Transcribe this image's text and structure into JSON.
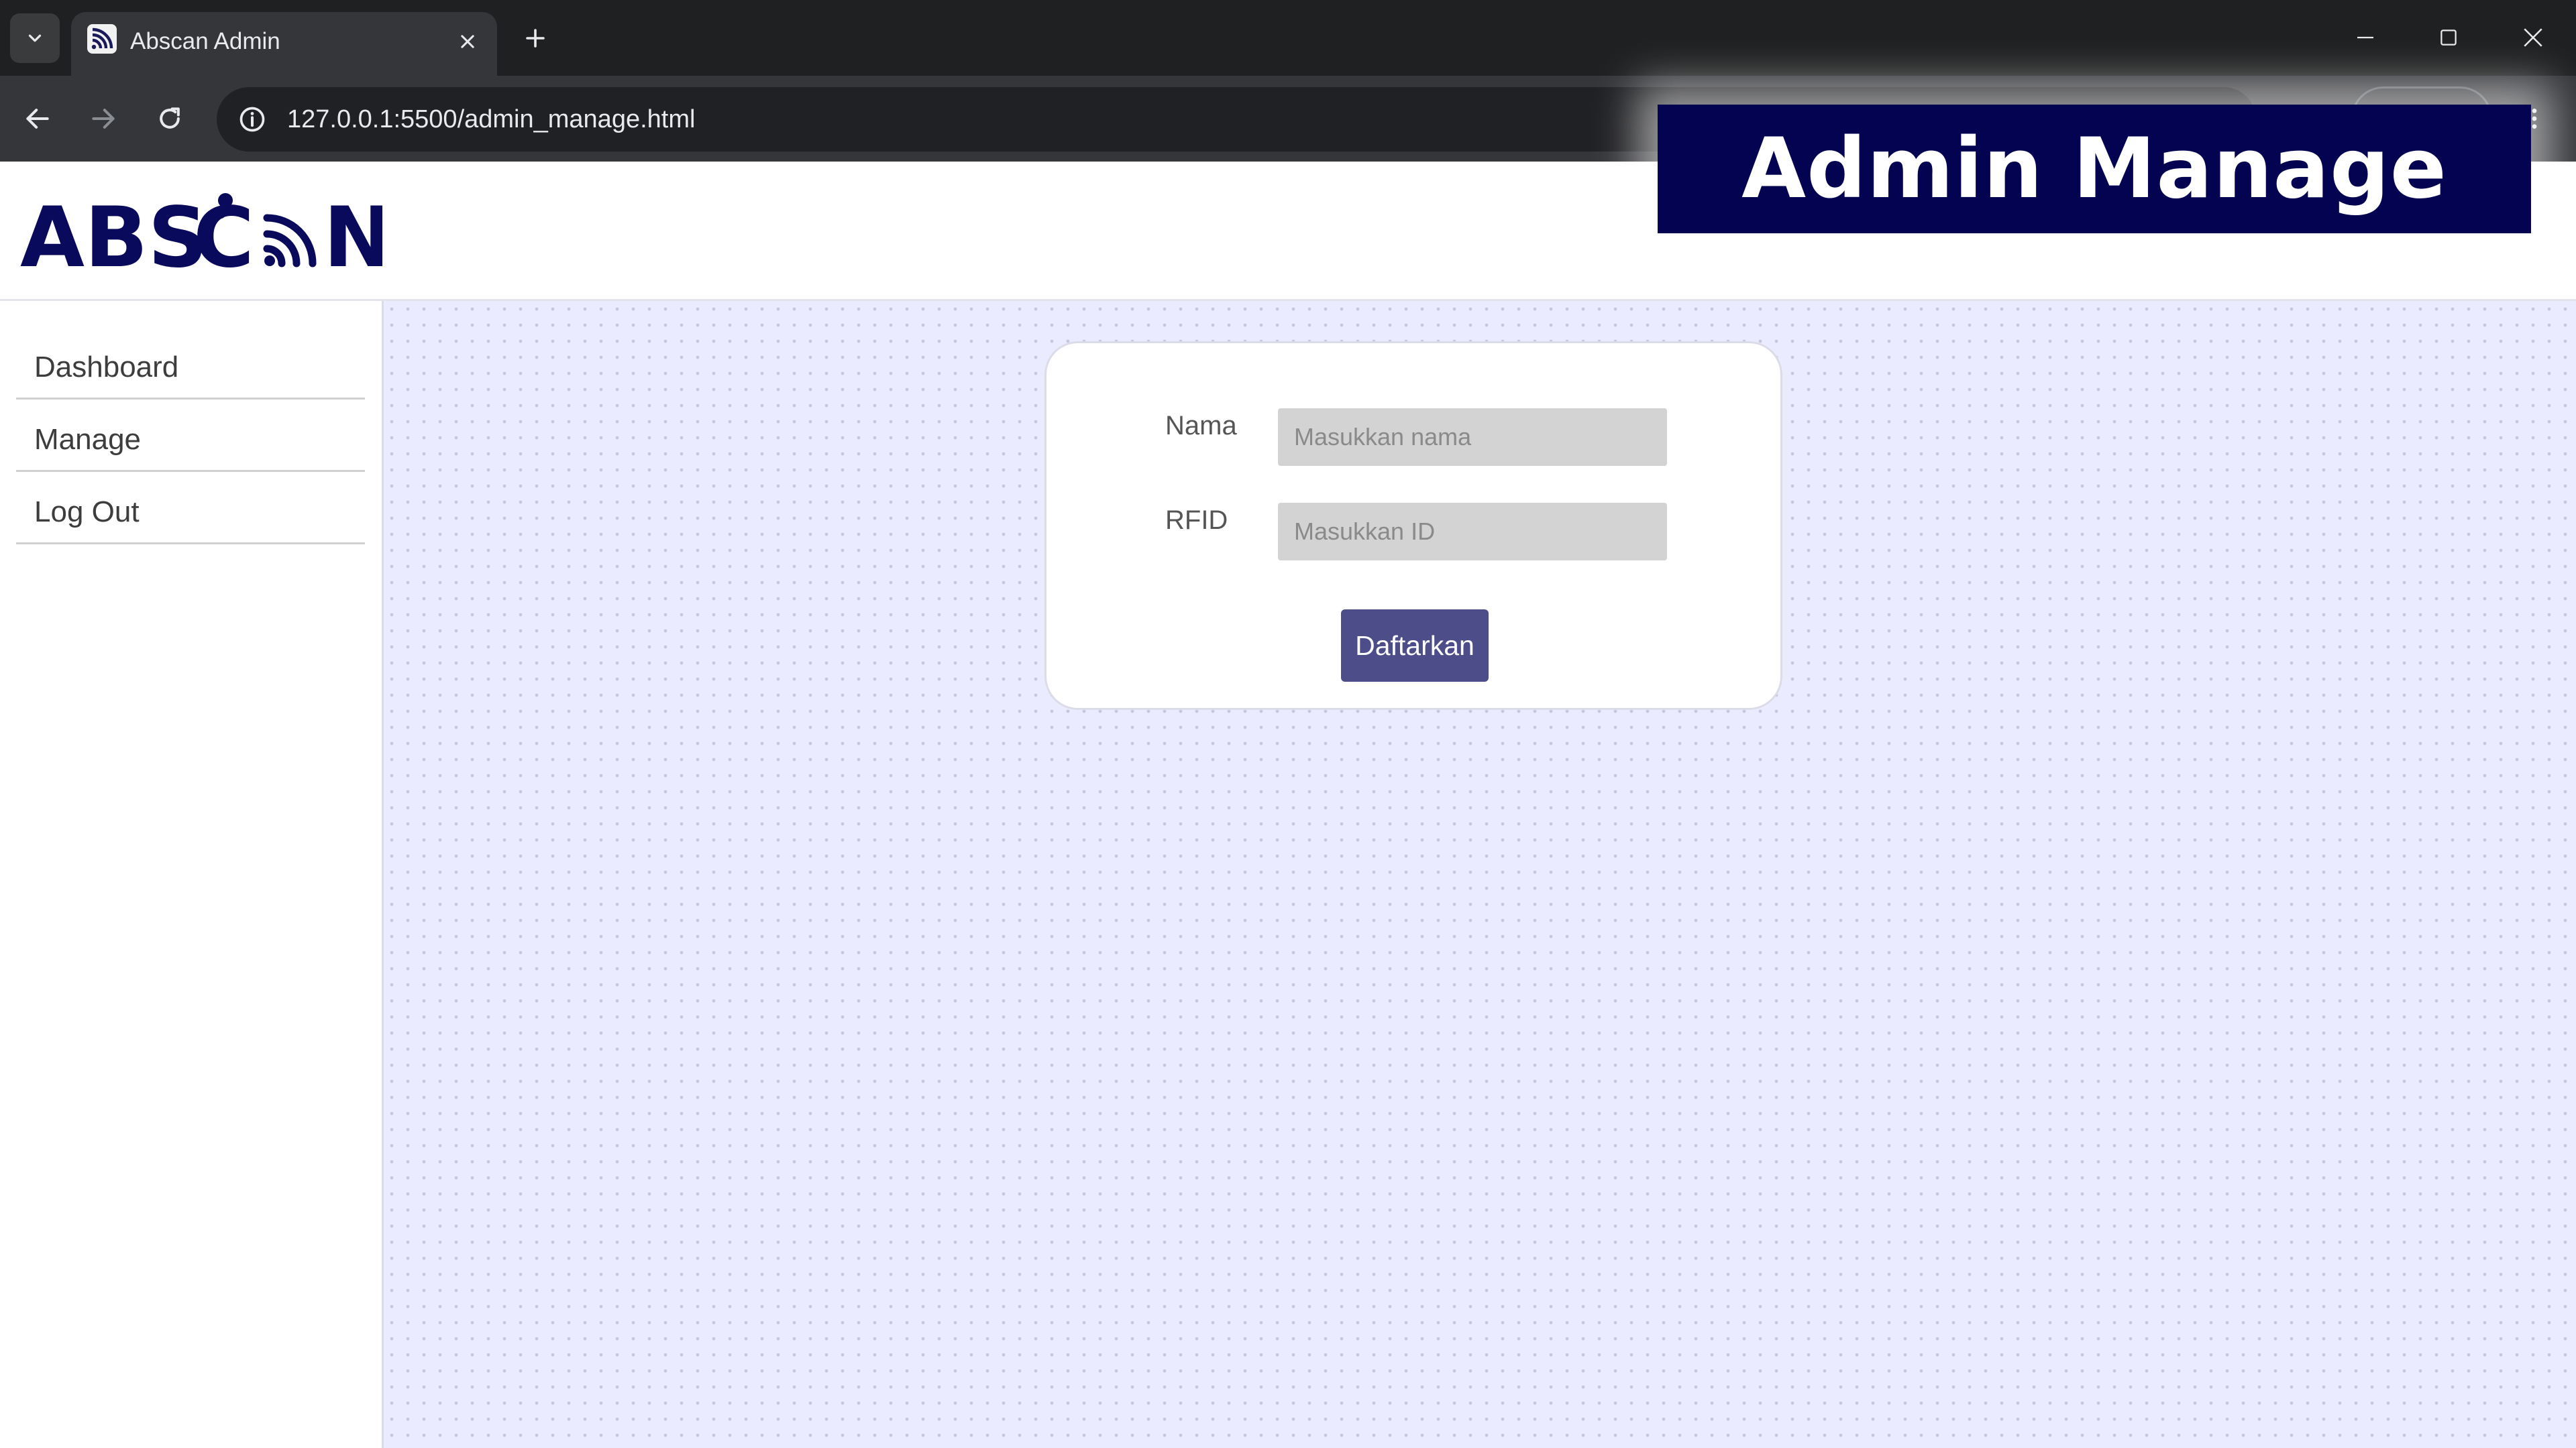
{
  "browser": {
    "tab_title": "Abscan Admin",
    "url": "127.0.0.1:5500/admin_manage.html"
  },
  "header": {
    "logo_text": "ABSCAN",
    "brand_color": "#0a0a5c"
  },
  "sidebar": {
    "items": [
      {
        "label": "Dashboard"
      },
      {
        "label": "Manage"
      },
      {
        "label": "Log Out"
      }
    ]
  },
  "form": {
    "name_label": "Nama",
    "name_placeholder": "Masukkan nama",
    "rfid_label": "RFID",
    "rfid_placeholder": "Masukkan ID",
    "submit_label": "Daftarkan",
    "submit_color": "#4d4d8a"
  },
  "overlay": {
    "title": "Admin Manage",
    "background": "#040352"
  },
  "icons": {
    "tab_search": "chevron-down-icon",
    "favicon": "rfid-signal-icon",
    "tab_close": "close-icon",
    "new_tab": "plus-icon",
    "back": "arrow-left-icon",
    "forward": "arrow-right-icon",
    "reload": "reload-icon",
    "site_info": "info-icon",
    "menu": "kebab-menu-icon",
    "minimize": "minimize-icon",
    "maximize": "maximize-icon",
    "close_window": "close-icon"
  }
}
